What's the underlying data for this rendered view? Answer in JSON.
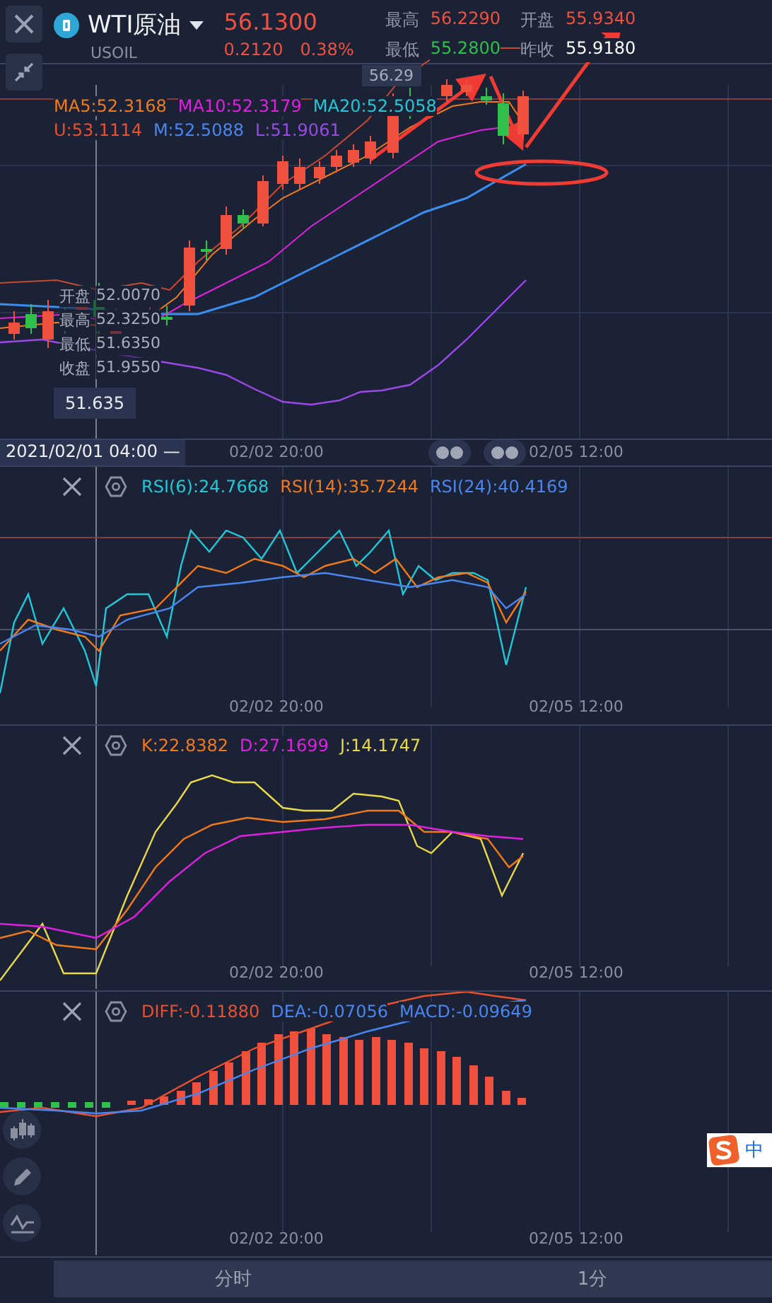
{
  "header": {
    "symbol": "WTI原油",
    "code": "USOIL",
    "price": "56.1300",
    "change": "0.2120",
    "change_pct": "0.38%",
    "stats": [
      {
        "label": "最高",
        "value": "56.2290",
        "color": "#f0513f"
      },
      {
        "label": "开盘",
        "value": "55.9340",
        "color": "#f0513f"
      },
      {
        "label": "最低",
        "value": "55.2800",
        "color": "#2fbf4a"
      },
      {
        "label": "昨收",
        "value": "55.9180",
        "color": "#ffffff"
      }
    ]
  },
  "main_chart": {
    "price_tag": "56.29",
    "legend_rows": [
      [
        {
          "text": "MA5:52.3168",
          "color": "#f07a1a"
        },
        {
          "text": "MA10:52.3179",
          "color": "#e020e0"
        },
        {
          "text": "MA20:52.5058",
          "color": "#20c8d8"
        }
      ],
      [
        {
          "text": "U:53.1114",
          "color": "#e8502e"
        },
        {
          "text": "M:52.5088",
          "color": "#4a86f0"
        },
        {
          "text": "L:51.9061",
          "color": "#9a48e8"
        }
      ]
    ],
    "tooltip": [
      {
        "label": "开盘",
        "value": "52.0070"
      },
      {
        "label": "最高",
        "value": "52.3250"
      },
      {
        "label": "最低",
        "value": "51.6350"
      },
      {
        "label": "收盘",
        "value": "51.9550"
      }
    ],
    "crosshair_price": "51.635"
  },
  "time_axis": {
    "crosshair_time": "2021/02/01 04:00 —",
    "labels": [
      "02/02 20:00",
      "02/05 12:00"
    ]
  },
  "indicators": [
    {
      "kind": "rsi",
      "legend": [
        {
          "text": "RSI(6):24.7668",
          "color": "#20c8d8"
        },
        {
          "text": "RSI(14):35.7244",
          "color": "#f07a1a"
        },
        {
          "text": "RSI(24):40.4169",
          "color": "#4a86f0"
        }
      ],
      "time_labels": [
        "02/02 20:00",
        "02/05 12:00"
      ]
    },
    {
      "kind": "kdj",
      "legend": [
        {
          "text": "K:22.8382",
          "color": "#f07a1a"
        },
        {
          "text": "D:27.1699",
          "color": "#e020e0"
        },
        {
          "text": "J:14.1747",
          "color": "#e8d84a"
        }
      ],
      "time_labels": [
        "02/02 20:00",
        "02/05 12:00"
      ]
    },
    {
      "kind": "macd",
      "legend": [
        {
          "text": "DIFF:-0.11880",
          "color": "#e8502e"
        },
        {
          "text": "DEA:-0.07056",
          "color": "#4a86f0"
        },
        {
          "text": "MACD:-0.09649",
          "color": "#4a86f0"
        }
      ],
      "time_labels": [
        "02/02 20:00",
        "02/05 12:00"
      ]
    }
  ],
  "tabs": [
    {
      "label": "分时",
      "selected": false
    },
    {
      "label": "1分",
      "selected": false
    }
  ],
  "ime_badge": "中"
}
